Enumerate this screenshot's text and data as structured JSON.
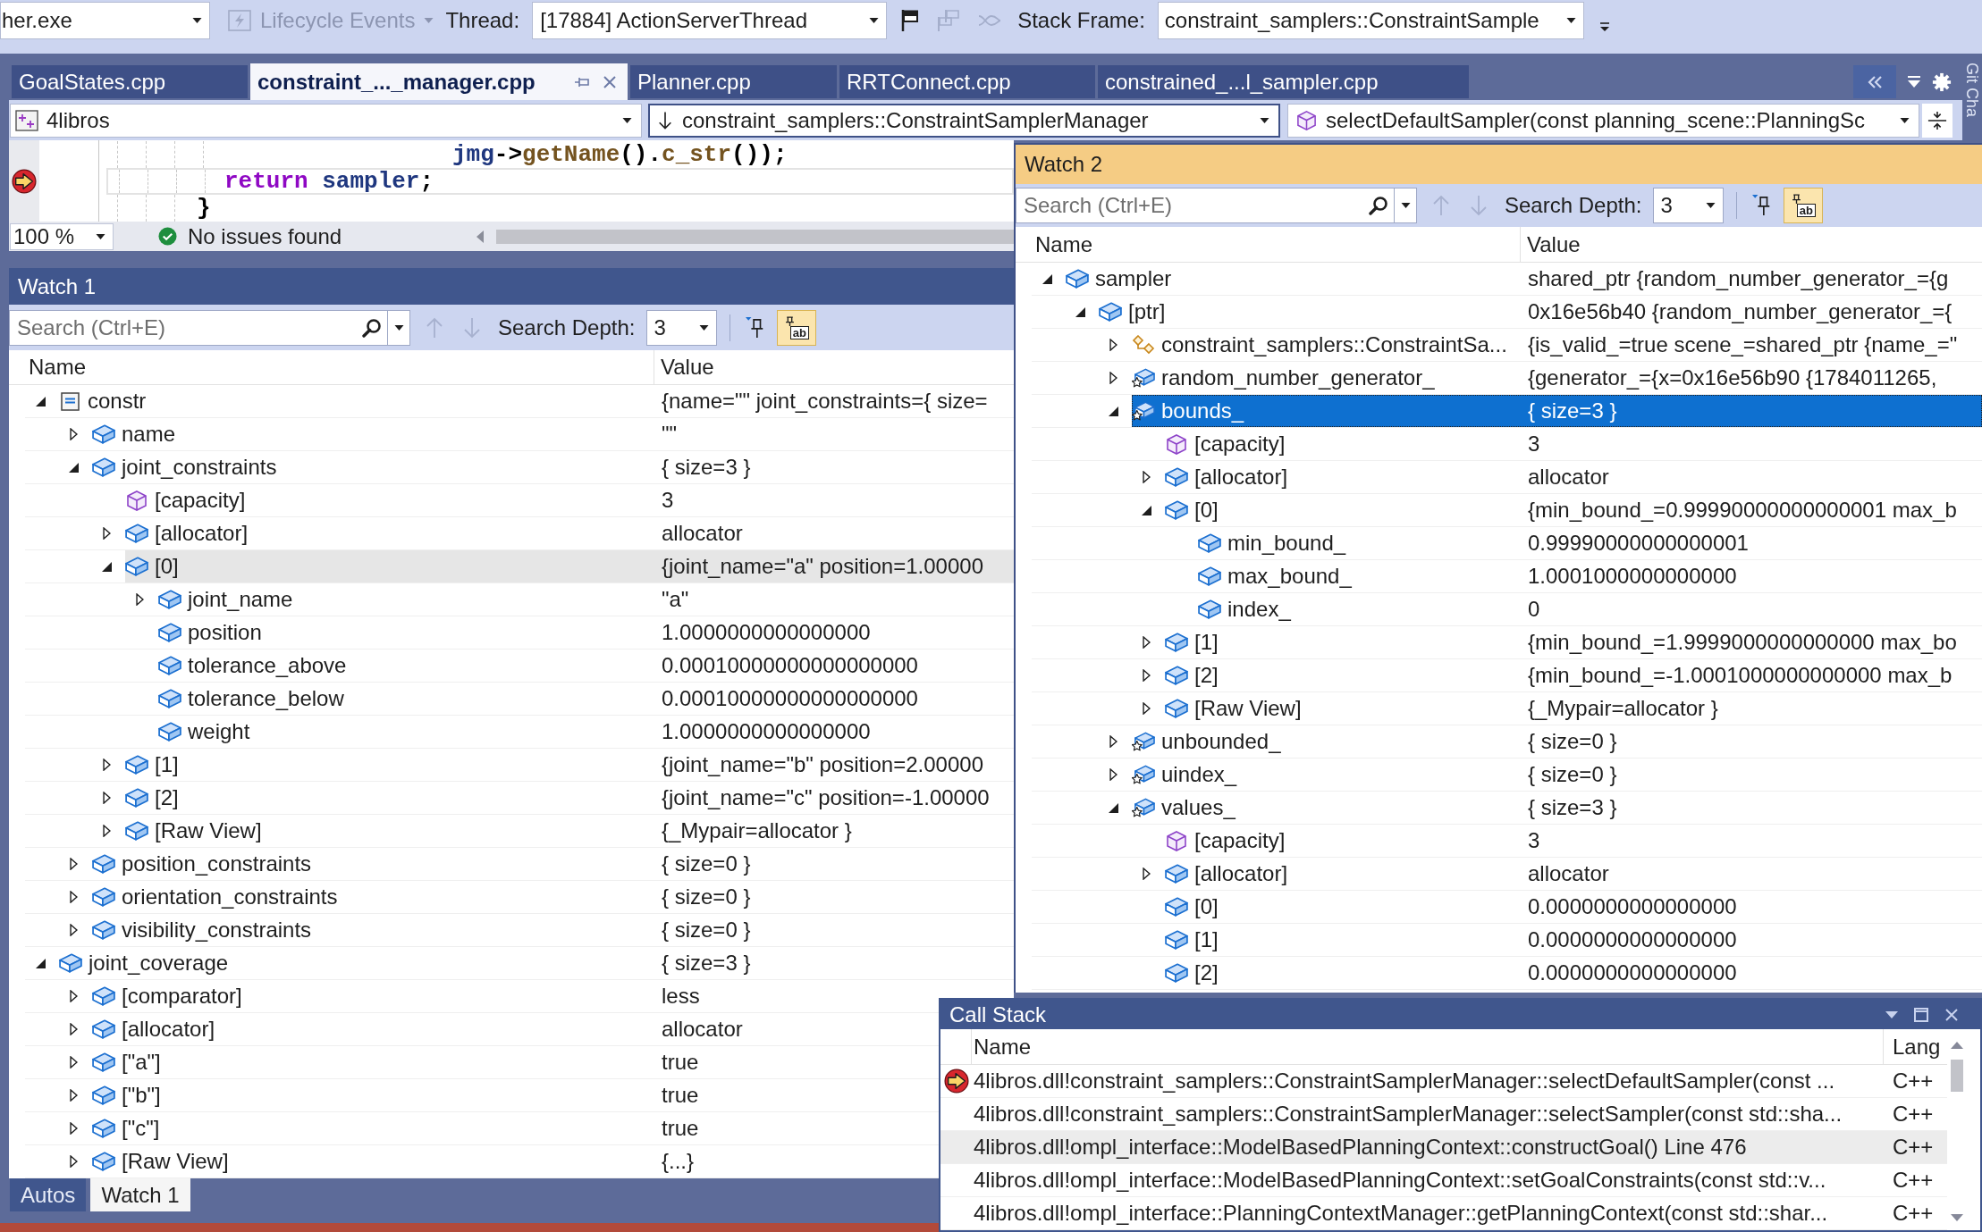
{
  "debug_toolbar": {
    "process": "her.exe",
    "lifecycle": {
      "label": "Lifecycle Events",
      "disabled": true
    },
    "thread_label": "Thread:",
    "thread": "[17884] ActionServerThread",
    "tools": [
      {
        "kind": "flag",
        "disabled": false
      },
      {
        "kind": "flags",
        "disabled": true
      },
      {
        "kind": "threads",
        "disabled": true
      }
    ],
    "stack_frame_label": "Stack Frame:",
    "stack_frame": "constraint_samplers::ConstraintSample"
  },
  "editor": {
    "tabs": [
      {
        "label": "GoalStates.cpp",
        "selected": false
      },
      {
        "label": "constraint_..._manager.cpp",
        "selected": true
      },
      {
        "label": "Planner.cpp",
        "selected": false
      },
      {
        "label": "RRTConnect.cpp",
        "selected": false
      },
      {
        "label": "constrained_...l_sampler.cpp",
        "selected": false
      }
    ],
    "navigation": {
      "project": "4libros",
      "scope": "constraint_samplers::ConstraintSamplerManager",
      "member": "selectDefaultSampler(const planning_scene::PlanningSc"
    },
    "code": [
      {
        "current": false,
        "tokens": [
          {
            "text": "jmg",
            "kind": "variable"
          },
          {
            "text": "->",
            "kind": "punctuation"
          },
          {
            "text": "getName",
            "kind": "function"
          },
          {
            "text": "().",
            "kind": "punctuation"
          },
          {
            "text": "c_str",
            "kind": "function"
          },
          {
            "text": "());",
            "kind": "punctuation"
          }
        ]
      },
      {
        "current": true,
        "tokens": [
          {
            "text": "return ",
            "kind": "keyword"
          },
          {
            "text": "sampler",
            "kind": "variable"
          },
          {
            "text": ";",
            "kind": "punctuation"
          }
        ]
      },
      {
        "current": false,
        "tokens": [
          {
            "text": "}",
            "kind": "punctuation"
          }
        ]
      }
    ],
    "zoom": "100 %",
    "issues": "No issues found"
  },
  "side_tab": "Git Cha",
  "watch1": {
    "title": "Watch 1",
    "active": false,
    "search": {
      "placeholder": "Search (Ctrl+E)"
    },
    "navigation": {
      "disabled": true
    },
    "depth_label": "Search Depth:",
    "depth": "3",
    "pin_on": false,
    "raw_toggle": {
      "label": "ab",
      "on": true
    },
    "columns": [
      "Name",
      "Value"
    ],
    "rows": [
      {
        "name": "constr",
        "value": "{name=\"\" joint_constraints={ size=",
        "kind": "variable",
        "expandable": true,
        "selected": false,
        "children": [
          {
            "name": "name",
            "value": "\"\"",
            "kind": "field",
            "expandable": true,
            "selected": false
          },
          {
            "name": "joint_constraints",
            "value": "{ size=3 }",
            "kind": "field",
            "expandable": true,
            "selected": false,
            "children": [
              {
                "name": "[capacity]",
                "value": "3",
                "kind": "property",
                "expandable": false,
                "selected": false
              },
              {
                "name": "[allocator]",
                "value": "allocator",
                "kind": "field",
                "expandable": true,
                "selected": false
              },
              {
                "name": "[0]",
                "value": "{joint_name=\"a\" position=1.00000",
                "kind": "field",
                "expandable": true,
                "selected": true,
                "children": [
                  {
                    "name": "joint_name",
                    "value": "\"a\"",
                    "kind": "field",
                    "expandable": true,
                    "selected": false
                  },
                  {
                    "name": "position",
                    "value": "1.0000000000000000",
                    "kind": "field",
                    "expandable": false,
                    "selected": false
                  },
                  {
                    "name": "tolerance_above",
                    "value": "0.00010000000000000000",
                    "kind": "field",
                    "expandable": false,
                    "selected": false
                  },
                  {
                    "name": "tolerance_below",
                    "value": "0.00010000000000000000",
                    "kind": "field",
                    "expandable": false,
                    "selected": false
                  },
                  {
                    "name": "weight",
                    "value": "1.0000000000000000",
                    "kind": "field",
                    "expandable": false,
                    "selected": false
                  }
                ]
              },
              {
                "name": "[1]",
                "value": "{joint_name=\"b\" position=2.00000",
                "kind": "field",
                "expandable": true,
                "selected": false
              },
              {
                "name": "[2]",
                "value": "{joint_name=\"c\" position=-1.00000",
                "kind": "field",
                "expandable": true,
                "selected": false
              },
              {
                "name": "[Raw View]",
                "value": "{_Mypair=allocator }",
                "kind": "field",
                "expandable": true,
                "selected": false
              }
            ]
          },
          {
            "name": "position_constraints",
            "value": "{ size=0 }",
            "kind": "field",
            "expandable": true,
            "selected": false
          },
          {
            "name": "orientation_constraints",
            "value": "{ size=0 }",
            "kind": "field",
            "expandable": true,
            "selected": false
          },
          {
            "name": "visibility_constraints",
            "value": "{ size=0 }",
            "kind": "field",
            "expandable": true,
            "selected": false
          }
        ]
      },
      {
        "name": "joint_coverage",
        "value": "{ size=3 }",
        "kind": "field",
        "expandable": true,
        "selected": false,
        "children": [
          {
            "name": "[comparator]",
            "value": "less",
            "kind": "field",
            "expandable": true,
            "selected": false
          },
          {
            "name": "[allocator]",
            "value": "allocator",
            "kind": "field",
            "expandable": true,
            "selected": false
          },
          {
            "name": "[\"a\"]",
            "value": "true",
            "kind": "field",
            "expandable": true,
            "selected": false
          },
          {
            "name": "[\"b\"]",
            "value": "true",
            "kind": "field",
            "expandable": true,
            "selected": false
          },
          {
            "name": "[\"c\"]",
            "value": "true",
            "kind": "field",
            "expandable": true,
            "selected": false
          },
          {
            "name": "[Raw View]",
            "value": "{...}",
            "kind": "field",
            "expandable": true,
            "selected": false
          }
        ]
      }
    ]
  },
  "tool_tabs": [
    {
      "label": "Autos",
      "selected": false
    },
    {
      "label": "Watch 1",
      "selected": true
    }
  ],
  "watch2": {
    "title": "Watch 2",
    "active": true,
    "search": {
      "placeholder": "Search (Ctrl+E)"
    },
    "navigation": {
      "disabled": true
    },
    "depth_label": "Search Depth:",
    "depth": "3",
    "pin_on": false,
    "raw_toggle": {
      "label": "ab",
      "on": true
    },
    "columns": [
      "Name",
      "Value"
    ],
    "rows": [
      {
        "name": "sampler",
        "value": "shared_ptr {random_number_generator_={g",
        "kind": "field",
        "expandable": true,
        "selected": false,
        "children": [
          {
            "name": "[ptr]",
            "value": "0x16e56b40 {random_number_generator_={",
            "kind": "field",
            "expandable": true,
            "selected": false,
            "children": [
              {
                "name": "constraint_samplers::ConstraintSa...",
                "value": "{is_valid_=true scene_=shared_ptr {name_=\"",
                "kind": "base-class",
                "expandable": true,
                "selected": false
              },
              {
                "name": "random_number_generator_",
                "value": "{generator_={x=0x16e56b90 {1784011265,",
                "kind": "protected-field",
                "expandable": true,
                "selected": false
              },
              {
                "name": "bounds_",
                "value": "{ size=3 }",
                "kind": "protected-field",
                "expandable": true,
                "selected": true,
                "children": [
                  {
                    "name": "[capacity]",
                    "value": "3",
                    "kind": "property",
                    "expandable": false,
                    "selected": false
                  },
                  {
                    "name": "[allocator]",
                    "value": "allocator",
                    "kind": "field",
                    "expandable": true,
                    "selected": false
                  },
                  {
                    "name": "[0]",
                    "value": "{min_bound_=0.99990000000000001 max_b",
                    "kind": "field",
                    "expandable": true,
                    "selected": false,
                    "children": [
                      {
                        "name": "min_bound_",
                        "value": "0.99990000000000001",
                        "kind": "field",
                        "expandable": false,
                        "selected": false
                      },
                      {
                        "name": "max_bound_",
                        "value": "1.0001000000000000",
                        "kind": "field",
                        "expandable": false,
                        "selected": false
                      },
                      {
                        "name": "index_",
                        "value": "0",
                        "kind": "field",
                        "expandable": false,
                        "selected": false
                      }
                    ]
                  },
                  {
                    "name": "[1]",
                    "value": "{min_bound_=1.9999000000000000 max_bo",
                    "kind": "field",
                    "expandable": true,
                    "selected": false
                  },
                  {
                    "name": "[2]",
                    "value": "{min_bound_=-1.0001000000000000 max_b",
                    "kind": "field",
                    "expandable": true,
                    "selected": false
                  },
                  {
                    "name": "[Raw View]",
                    "value": "{_Mypair=allocator }",
                    "kind": "field",
                    "expandable": true,
                    "selected": false
                  }
                ]
              },
              {
                "name": "unbounded_",
                "value": "{ size=0 }",
                "kind": "protected-field",
                "expandable": true,
                "selected": false
              },
              {
                "name": "uindex_",
                "value": "{ size=0 }",
                "kind": "protected-field",
                "expandable": true,
                "selected": false
              },
              {
                "name": "values_",
                "value": "{ size=3 }",
                "kind": "protected-field",
                "expandable": true,
                "selected": false,
                "children": [
                  {
                    "name": "[capacity]",
                    "value": "3",
                    "kind": "property",
                    "expandable": false,
                    "selected": false
                  },
                  {
                    "name": "[allocator]",
                    "value": "allocator",
                    "kind": "field",
                    "expandable": true,
                    "selected": false
                  },
                  {
                    "name": "[0]",
                    "value": "0.0000000000000000",
                    "kind": "field",
                    "expandable": false,
                    "selected": false
                  },
                  {
                    "name": "[1]",
                    "value": "0.0000000000000000",
                    "kind": "field",
                    "expandable": false,
                    "selected": false
                  },
                  {
                    "name": "[2]",
                    "value": "0.0000000000000000",
                    "kind": "field",
                    "expandable": false,
                    "selected": false
                  }
                ]
              }
            ]
          }
        ]
      }
    ]
  },
  "call_stack": {
    "title": "Call Stack",
    "active": false,
    "columns": [
      "Name",
      "Lang"
    ],
    "frames": [
      {
        "name": "4libros.dll!constraint_samplers::ConstraintSamplerManager::selectDefaultSampler(const ...",
        "lang": "C++",
        "current": true,
        "selected": false
      },
      {
        "name": "4libros.dll!constraint_samplers::ConstraintSamplerManager::selectSampler(const std::sha...",
        "lang": "C++",
        "current": false,
        "selected": false
      },
      {
        "name": "4libros.dll!ompl_interface::ModelBasedPlanningContext::constructGoal() Line 476",
        "lang": "C++",
        "current": false,
        "selected": true
      },
      {
        "name": "4libros.dll!ompl_interface::ModelBasedPlanningContext::setGoalConstraints(const std::v...",
        "lang": "C++",
        "current": false,
        "selected": false
      },
      {
        "name": "4libros.dll!ompl_interface::PlanningContextManager::getPlanningContext(const std::shar...",
        "lang": "C++",
        "current": false,
        "selected": false
      }
    ]
  }
}
